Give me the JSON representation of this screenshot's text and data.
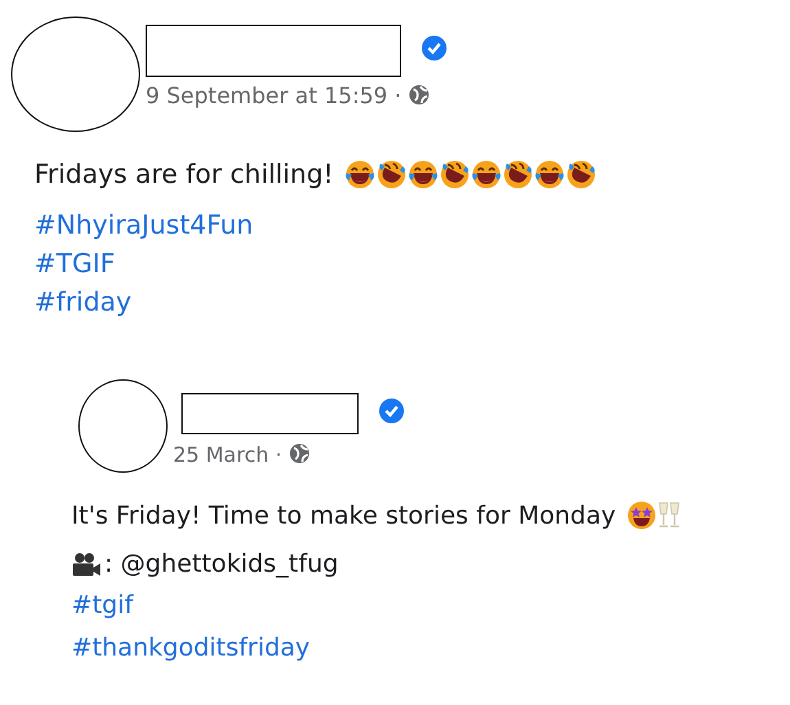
{
  "posts": [
    {
      "kind": "main",
      "verified": true,
      "date": "9 September at 15:59 ·",
      "text": "Fridays are for chilling!",
      "emojis": [
        {
          "kind": "laugh"
        },
        {
          "kind": "rofl"
        },
        {
          "kind": "laugh"
        },
        {
          "kind": "rofl"
        },
        {
          "kind": "laugh"
        },
        {
          "kind": "rofl"
        },
        {
          "kind": "laugh"
        },
        {
          "kind": "rofl"
        }
      ],
      "hashtags": [
        "#NhyiraJust4Fun",
        "#TGIF",
        "#friday"
      ]
    },
    {
      "kind": "shared",
      "verified": true,
      "date": "25 March ·",
      "text": "It's Friday! Time to make stories for Monday",
      "emojis": [
        {
          "kind": "starstruck"
        },
        {
          "kind": "glasses"
        }
      ],
      "credit": ": @ghettokids_tfug",
      "hashtags": [
        "#tgif",
        "#thankgoditsfriday"
      ]
    }
  ]
}
